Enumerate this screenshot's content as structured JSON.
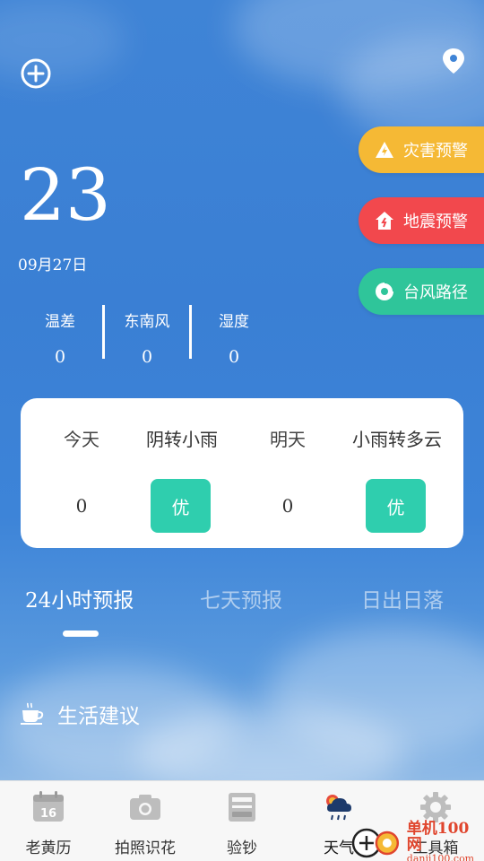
{
  "header": {
    "add_icon": "plus-circle-icon",
    "location_icon": "location-pin-icon"
  },
  "weather": {
    "temperature": "23",
    "date": "09月27日"
  },
  "stats": [
    {
      "label": "温差",
      "value": "0"
    },
    {
      "label": "东南风",
      "value": "0"
    },
    {
      "label": "湿度",
      "value": "0"
    }
  ],
  "alerts": {
    "disaster": {
      "label": "灾害预警",
      "color": "#f5b935",
      "icon": "warning-triangle-icon"
    },
    "earthquake": {
      "label": "地震预警",
      "color": "#f2484d",
      "icon": "earthquake-house-icon"
    },
    "typhoon": {
      "label": "台风路径",
      "color": "#2fc59a",
      "icon": "typhoon-icon"
    }
  },
  "forecast_card": {
    "today_label": "今天",
    "today_condition": "阴转小雨",
    "tomorrow_label": "明天",
    "tomorrow_condition": "小雨转多云",
    "today_value": "0",
    "today_quality": "优",
    "tomorrow_value": "0",
    "tomorrow_quality": "优",
    "quality_color": "#2fceae"
  },
  "tabs": [
    {
      "label": "24小时预报",
      "active": true
    },
    {
      "label": "七天预报",
      "active": false
    },
    {
      "label": "日出日落",
      "active": false
    }
  ],
  "life_section": {
    "title": "生活建议",
    "icon": "coffee-cup-icon"
  },
  "bottom_nav": [
    {
      "label": "老黄历",
      "icon": "calendar-icon",
      "calendar_day": "16"
    },
    {
      "label": "拍照识花",
      "icon": "camera-icon"
    },
    {
      "label": "验钞",
      "icon": "banknote-checker-icon"
    },
    {
      "label": "天气",
      "icon": "weather-rain-cloud-icon",
      "active": true
    },
    {
      "label": "工具箱",
      "icon": "gear-icon"
    }
  ],
  "watermark": {
    "text": "单机100网",
    "sub": "danji100.com"
  }
}
